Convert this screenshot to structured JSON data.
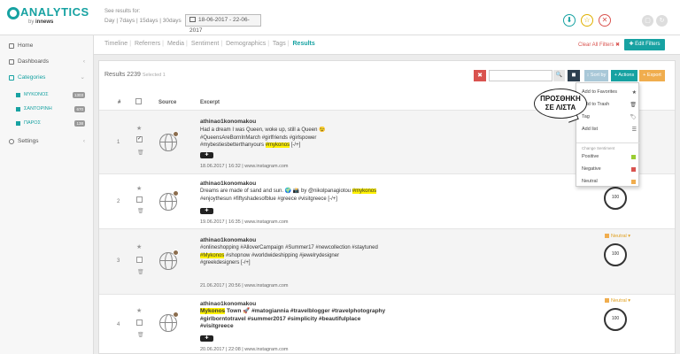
{
  "header": {
    "logo_text": "ANALYTICS",
    "logo_by": "by",
    "logo_brand": "innews",
    "see_results_for": "See results for:",
    "ranges": "Day | 7days | 15days | 30days",
    "date_range": "18-06-2017 - 22-06-2017"
  },
  "sidebar": {
    "home": "Home",
    "dashboards": "Dashboards",
    "categories": "Categories",
    "subcategories": [
      {
        "label": "ΜΥΚΟΝΟΣ",
        "count": "1303"
      },
      {
        "label": "ΣΑΝΤΟΡΙΝΗ",
        "count": "670"
      },
      {
        "label": "ΠΑΡΟΣ",
        "count": "138"
      }
    ],
    "settings": "Settings"
  },
  "tabs": {
    "items": [
      "Timeline",
      "Referrers",
      "Media",
      "Sentiment",
      "Demographics",
      "Tags",
      "Results"
    ],
    "clear_all": "Clear All Filters ✖",
    "edit_filters": "Edit Filters"
  },
  "toolbar": {
    "results": "Results 2239",
    "selected": "Selected 1",
    "sort_by": "Sort by",
    "actions": "Actions",
    "export": "Export"
  },
  "table_headers": {
    "num": "#",
    "source": "Source",
    "excerpt": "Excerpt"
  },
  "rows": [
    {
      "num": "1",
      "author": "athinao1konomakou",
      "line1": "Had a dream I was Queen, woke up, still a Queen 😉",
      "line2": "#QueensAreBornInMarch #girlfriends #girlspower",
      "line3_pre": "#mybestiesbetterthanyours ",
      "line3_hl": "#mykonos",
      "line3_post": " [-/+]",
      "meta": "18.06.2017 | 16:32 | www.instagram.com"
    },
    {
      "num": "2",
      "author": "athinao1konomakou",
      "line1_pre": "Dreams are made of sand and sun. 🌍 📸 by @nikolpanagiotou ",
      "line1_hl": "#mykonos",
      "line2": "#enjoythesun #fiftyshadesofblue #greece #visitgreece [-/+]",
      "meta": "19.06.2017 | 16:35 | www.instagram.com",
      "score": "100"
    },
    {
      "num": "3",
      "author": "athinao1konomakou",
      "line1": "#onlineshopping #AlloverCampaign #Summer17 #newcollection #staytuned",
      "line2_hl": "#Mykonos",
      "line2_post": " #shopnow #worldwideshipping #jewelrydesigner",
      "line3": "#greekdesigners [-/+]",
      "meta": "21.06.2017 | 20:56 | www.instagram.com",
      "sentiment": "Neutral",
      "score": "100"
    },
    {
      "num": "4",
      "author": "athinao1konomakou",
      "line1_hl": "Mykonos",
      "line1_post": " Town 🚀 #matogiannia #travelblogger #travelphotography",
      "line2": "#girlborntotravel #summer2017 #simplicity #beautifulplace",
      "line3": "#visitgreece",
      "meta": "20.06.2017 | 22:08 | www.instagram.com",
      "sentiment": "Neutral",
      "score": "100"
    }
  ],
  "actions_menu": {
    "items": [
      "Add to Favorites",
      "Add to Trash",
      "Tag",
      "Add list"
    ],
    "change_sentiment": "Change Sentiment",
    "sentiments": [
      {
        "label": "Positive",
        "color": "#9acd32"
      },
      {
        "label": "Negative",
        "color": "#d9534f"
      },
      {
        "label": "Neutral",
        "color": "#f0ad4e"
      }
    ]
  },
  "callout": {
    "line1": "ΠΡΟΣΘΗΚΗ",
    "line2": "ΣΕ ΛΙΣΤΑ"
  },
  "colors": {
    "accent": "#17a2a2",
    "highlight": "#fff200",
    "danger": "#d9534f",
    "warning": "#f0ad4e"
  }
}
